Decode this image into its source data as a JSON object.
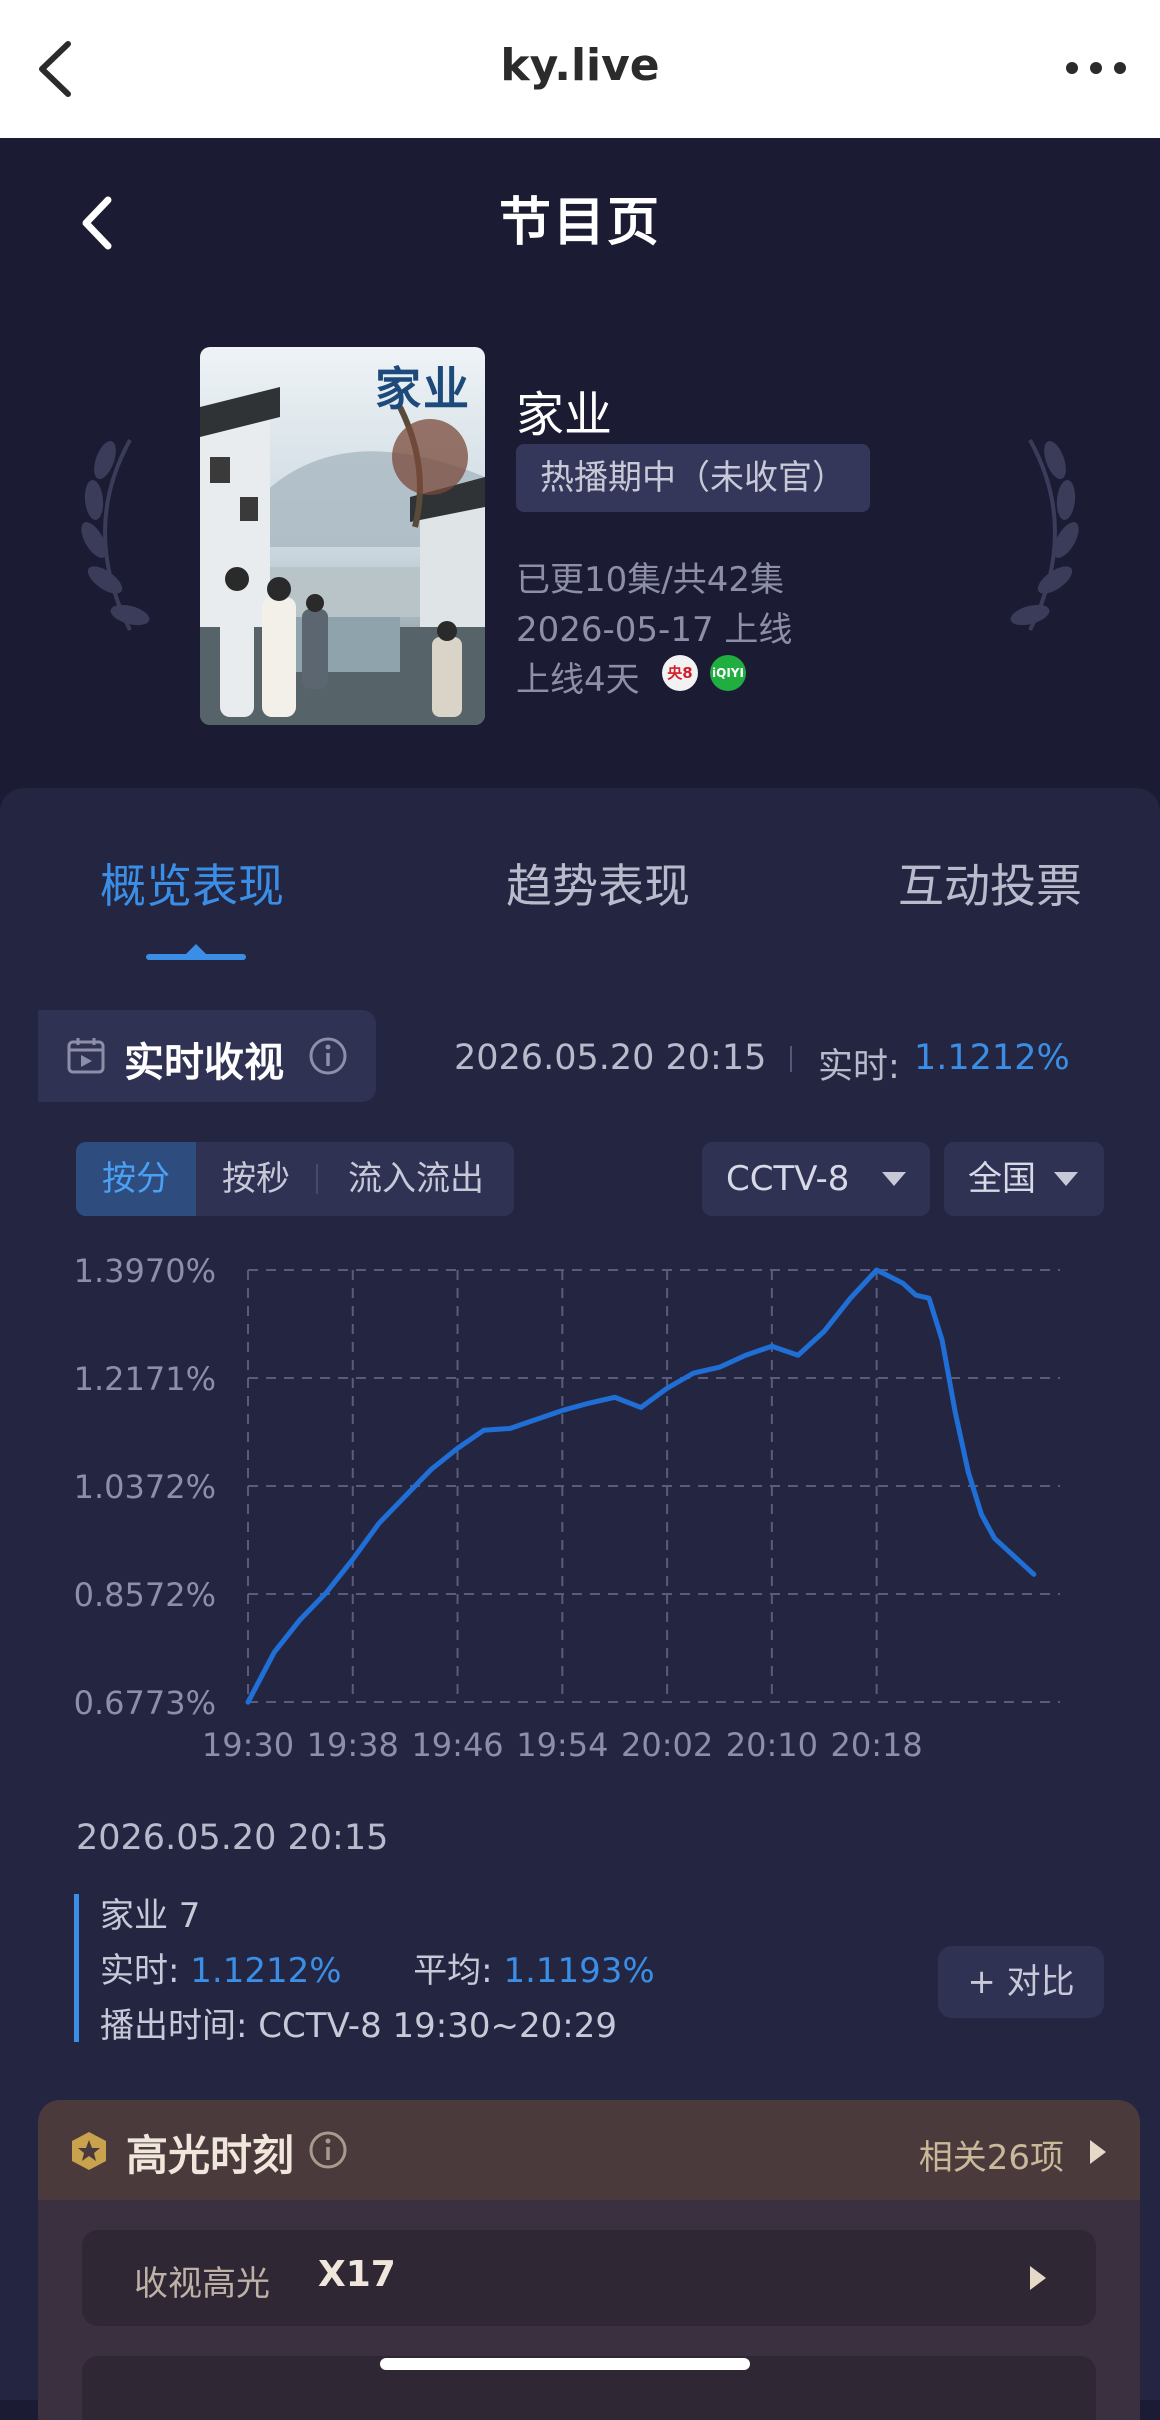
{
  "browser": {
    "title": "ky.live"
  },
  "header": {
    "title": "节目页"
  },
  "show": {
    "poster_title": "家业",
    "name": "家业",
    "status": "热播期中（未收官）",
    "episodes": "已更10集/共42集",
    "premiere": "2026-05-17 上线",
    "days_online": "上线4天",
    "platforms": [
      {
        "name": "央8",
        "color": "#d21f2b"
      },
      {
        "name": "iQIYI",
        "color": "#1fae3f"
      }
    ]
  },
  "tabs": [
    {
      "label": "概览表现",
      "active": true
    },
    {
      "label": "趋势表现",
      "active": false
    },
    {
      "label": "互动投票",
      "active": false
    }
  ],
  "realtime": {
    "label": "实时收视",
    "time": "2026.05.20 20:15",
    "value_label": "实时:",
    "value": "1.1212%"
  },
  "segments": [
    {
      "label": "按分",
      "active": true
    },
    {
      "label": "按秒",
      "active": false
    },
    {
      "label": "流入流出",
      "active": false
    }
  ],
  "filters": {
    "channel": "CCTV-8",
    "region": "全国"
  },
  "accent_color": "#3b8ee6",
  "chart_data": {
    "type": "line",
    "x_tick_labels": [
      "19:30",
      "19:38",
      "19:46",
      "19:54",
      "20:02",
      "20:10",
      "20:18"
    ],
    "y_tick_labels": [
      "1.3970%",
      "1.2171%",
      "1.0372%",
      "0.8572%",
      "0.6773%"
    ],
    "ylim": [
      0.6773,
      1.397
    ],
    "x_minutes_from_1930": [
      0,
      2,
      4,
      6,
      8,
      10,
      12,
      14,
      16,
      18,
      20,
      22,
      24,
      26,
      28,
      30,
      32,
      34,
      36,
      38,
      40,
      42,
      44,
      46,
      48,
      50,
      51,
      52,
      53,
      54,
      55,
      56,
      57,
      58,
      59,
      60
    ],
    "series": [
      {
        "values": [
          0.677,
          0.76,
          0.815,
          0.86,
          0.915,
          0.975,
          1.02,
          1.065,
          1.1,
          1.13,
          1.133,
          1.148,
          1.163,
          1.175,
          1.185,
          1.168,
          1.2,
          1.225,
          1.235,
          1.255,
          1.27,
          1.255,
          1.295,
          1.35,
          1.397,
          1.375,
          1.355,
          1.35,
          1.28,
          1.16,
          1.06,
          0.99,
          0.95,
          0.93,
          0.91,
          0.89
        ],
        "color": "#1f6fd6"
      }
    ],
    "grid": true
  },
  "selection": {
    "time": "2026.05.20 20:15",
    "episode": "家业 7",
    "realtime_label": "实时:",
    "realtime_value": "1.1212%",
    "avg_label": "平均:",
    "avg_value": "1.1193%",
    "air_label": "播出时间:",
    "air_value": "CCTV-8 19:30~20:29",
    "compare": "+ 对比"
  },
  "highlights": {
    "title": "高光时刻",
    "related": "相关26项",
    "rows": [
      {
        "label": "收视高光",
        "value": "X17"
      }
    ]
  }
}
